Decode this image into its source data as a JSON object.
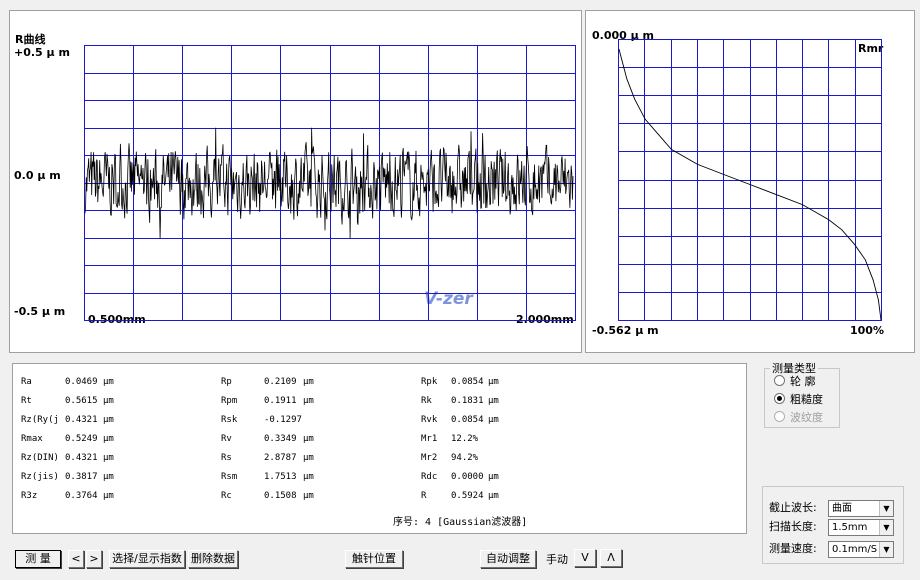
{
  "profile_chart": {
    "title": "R曲线",
    "y_top": "+0.5 μ m",
    "y_mid": "0.0 μ m",
    "y_bot": "-0.5 μ m",
    "x_start": "0.500mm",
    "x_end": "2.000mm",
    "watermark": "V-zer",
    "grid_color": "#1a1acc"
  },
  "mr_chart": {
    "y_top": "0.000 μ m",
    "y_bot": "-0.562 μ m",
    "label": "Rmr",
    "x_end": "100%"
  },
  "chart_data": [
    {
      "type": "line",
      "series": [
        {
          "points_count": 800,
          "mean": 0.0,
          "amplitude_um": [
            -0.2,
            0.2
          ]
        }
      ],
      "ylim": [
        -0.5,
        0.5
      ],
      "xlim": [
        0.5,
        2.0
      ],
      "xlabel": "",
      "ylabel": "",
      "grid": true
    },
    {
      "type": "line",
      "x": [
        0,
        1,
        3,
        6,
        10,
        15,
        20,
        30,
        40,
        50,
        60,
        70,
        80,
        85,
        90,
        94,
        97,
        99,
        100
      ],
      "y": [
        -0.02,
        -0.04,
        -0.08,
        -0.12,
        -0.16,
        -0.19,
        -0.22,
        -0.25,
        -0.27,
        -0.29,
        -0.31,
        -0.33,
        -0.36,
        -0.38,
        -0.41,
        -0.44,
        -0.48,
        -0.52,
        -0.56
      ],
      "ylim": [
        -0.562,
        0.0
      ],
      "xlim": [
        0,
        100
      ],
      "grid": true
    }
  ],
  "params": {
    "col1": [
      {
        "name": "Ra",
        "value": "0.0469",
        "unit": "μm"
      },
      {
        "name": "Rt",
        "value": "0.5615",
        "unit": "μm"
      },
      {
        "name": "Rz(Ry(j",
        "value": "0.4321",
        "unit": "μm"
      },
      {
        "name": "Rmax",
        "value": "0.5249",
        "unit": "μm"
      },
      {
        "name": "Rz(DIN)",
        "value": "0.4321",
        "unit": "μm"
      },
      {
        "name": "Rz(jis)",
        "value": "0.3817",
        "unit": "μm"
      },
      {
        "name": "R3z",
        "value": "0.3764",
        "unit": "μm"
      }
    ],
    "col2": [
      {
        "name": "Rp",
        "value": "0.2109",
        "unit": "μm"
      },
      {
        "name": "Rpm",
        "value": "0.1911",
        "unit": "μm"
      },
      {
        "name": "Rsk",
        "value": "-0.1297",
        "unit": ""
      },
      {
        "name": "Rv",
        "value": "0.3349",
        "unit": "μm"
      },
      {
        "name": "Rs",
        "value": "2.8787",
        "unit": "μm"
      },
      {
        "name": "Rsm",
        "value": "1.7513",
        "unit": "μm"
      },
      {
        "name": "Rc",
        "value": "0.1508",
        "unit": "μm"
      }
    ],
    "col3": [
      {
        "name": "Rpk",
        "value": "0.0854",
        "unit": "μm"
      },
      {
        "name": "Rk",
        "value": "0.1831",
        "unit": "μm"
      },
      {
        "name": "Rvk",
        "value": "0.0854",
        "unit": "μm"
      },
      {
        "name": "Mr1",
        "value": "12.2%",
        "unit": ""
      },
      {
        "name": "Mr2",
        "value": "94.2%",
        "unit": ""
      },
      {
        "name": "Rdc",
        "value": "0.0000",
        "unit": "μm"
      },
      {
        "name": "R",
        "value": "0.5924",
        "unit": "μm"
      }
    ],
    "sequence": "序号: 4 [Gaussian滤波器]"
  },
  "measure_type": {
    "legend": "测量类型",
    "options": [
      {
        "label": "轮  廓",
        "selected": false,
        "disabled": false
      },
      {
        "label": "粗糙度",
        "selected": true,
        "disabled": false
      },
      {
        "label": "波纹度",
        "selected": false,
        "disabled": true
      }
    ]
  },
  "settings": {
    "cutoff_label": "截止波长:",
    "cutoff_value": "曲面",
    "scan_label": "扫描长度:",
    "scan_value": "1.5mm",
    "speed_label": "测量速度:",
    "speed_value": "0.1mm/S"
  },
  "toolbar": {
    "measure": "测  量",
    "prev": "<",
    "next": ">",
    "select_display": "选择/显示指数",
    "delete_data": "删除数据",
    "stylus_position": "触针位置",
    "auto_adjust": "自动调整",
    "manual": "手动",
    "down": "V",
    "up": "Λ"
  }
}
